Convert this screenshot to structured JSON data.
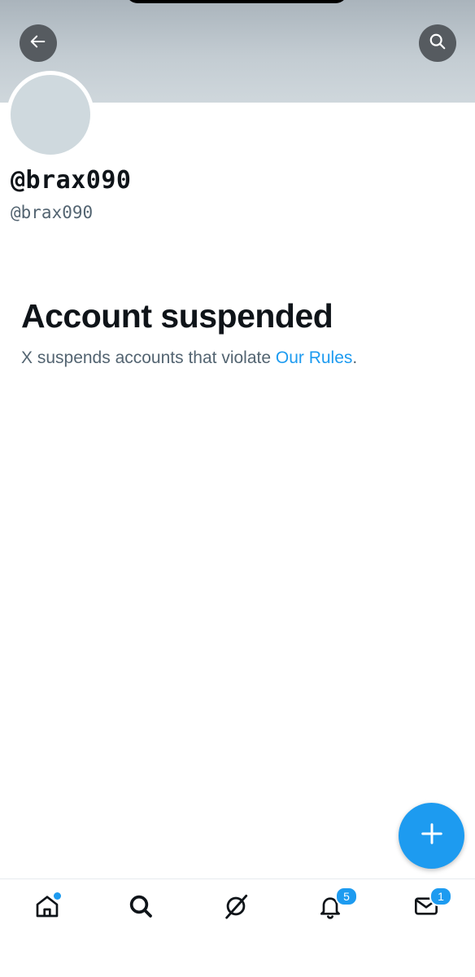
{
  "header": {
    "back_icon": "arrow-left-icon",
    "search_icon": "search-icon"
  },
  "profile": {
    "display_name": "@brax090",
    "handle": "@brax090"
  },
  "notice": {
    "title": "Account suspended",
    "body_prefix": "X suspends accounts that violate ",
    "link_text": "Our Rules",
    "body_suffix": "."
  },
  "fab": {
    "icon": "plus-icon"
  },
  "bottom_nav": {
    "items": [
      {
        "name": "home",
        "icon": "home-icon",
        "has_dot": true
      },
      {
        "name": "search",
        "icon": "search-icon"
      },
      {
        "name": "grok",
        "icon": "grok-icon"
      },
      {
        "name": "notifications",
        "icon": "bell-icon",
        "badge": "5"
      },
      {
        "name": "messages",
        "icon": "mail-icon",
        "badge": "1"
      }
    ]
  },
  "colors": {
    "accent": "#1d9bf0",
    "text_primary": "#0f1419",
    "text_secondary": "#536471"
  }
}
